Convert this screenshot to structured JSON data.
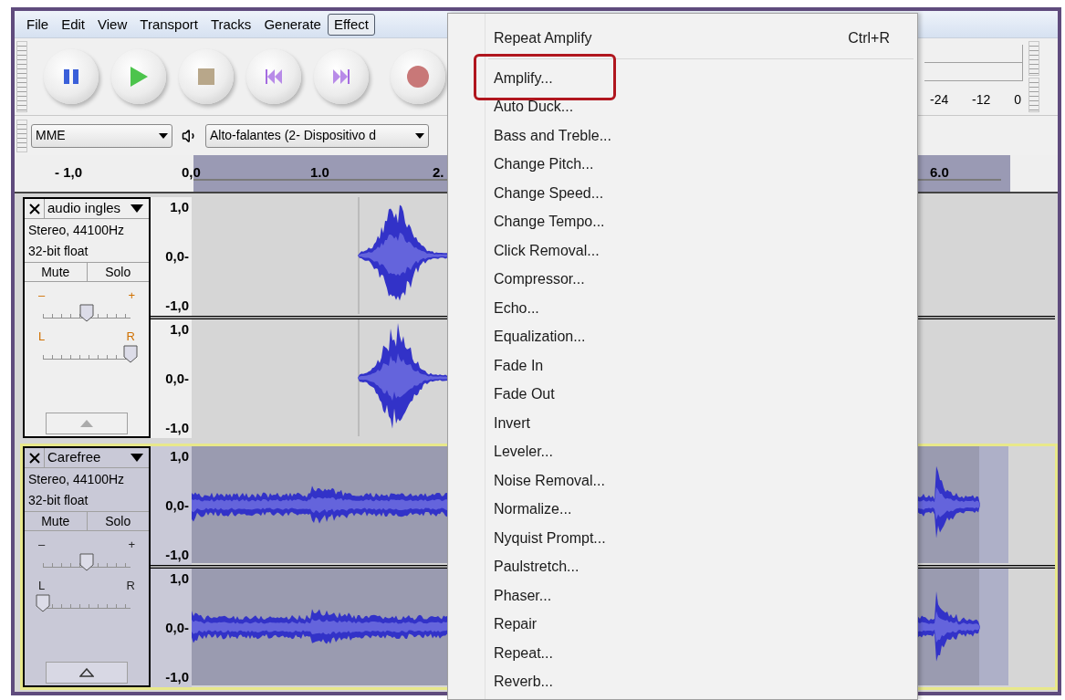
{
  "menubar": [
    {
      "label": "File",
      "selected": false
    },
    {
      "label": "Edit",
      "selected": false
    },
    {
      "label": "View",
      "selected": false
    },
    {
      "label": "Transport",
      "selected": false
    },
    {
      "label": "Tracks",
      "selected": false
    },
    {
      "label": "Generate",
      "selected": false
    },
    {
      "label": "Effect",
      "selected": true
    }
  ],
  "transport_buttons": [
    {
      "kind": "pause"
    },
    {
      "kind": "play"
    },
    {
      "kind": "stop"
    },
    {
      "kind": "skip-start"
    },
    {
      "kind": "skip-end"
    },
    {
      "kind": "record"
    }
  ],
  "meter": {
    "labels": [
      "-24",
      "-12",
      "0"
    ]
  },
  "device_toolbar": {
    "host": "MME",
    "output_device": "Alto-falantes (2- Dispositivo d"
  },
  "ruler": {
    "labels": [
      "- 1,0",
      "0,0",
      "1.0",
      "2.",
      "6.0"
    ]
  },
  "tracks": [
    {
      "name": "audio ingles",
      "info": [
        "Stereo, 44100Hz",
        "32-bit float"
      ],
      "mute": "Mute",
      "solo": "Solo",
      "selected": false,
      "gain": {
        "min_label": "–",
        "max_label": "+",
        "level": 0.5
      },
      "pan": {
        "min_label": "L",
        "max_label": "R",
        "level": 1
      },
      "channels": [
        {
          "scale": [
            "1,0",
            "0,0-",
            "-1,0"
          ]
        },
        {
          "scale": [
            "1,0",
            "0,0-",
            "-1,0"
          ]
        }
      ]
    },
    {
      "name": "Carefree",
      "info": [
        "Stereo, 44100Hz",
        "32-bit float"
      ],
      "mute": "Mute",
      "solo": "Solo",
      "selected": true,
      "gain": {
        "min_label": "–",
        "max_label": "+",
        "level": 0.5
      },
      "pan": {
        "min_label": "L",
        "max_label": "R",
        "level": 0
      },
      "channels": [
        {
          "scale": [
            "1,0",
            "0,0-",
            "-1,0"
          ]
        },
        {
          "scale": [
            "1,0",
            "0,0-",
            "-1,0"
          ]
        }
      ]
    }
  ],
  "effect_menu": {
    "recent": {
      "label": "Repeat Amplify",
      "shortcut": "Ctrl+R"
    },
    "items": [
      {
        "label": "Amplify...",
        "highlighted": true
      },
      {
        "label": "Auto Duck...",
        "highlighted": false
      },
      {
        "label": "Bass and Treble...",
        "highlighted": false
      },
      {
        "label": "Change Pitch...",
        "highlighted": false
      },
      {
        "label": "Change Speed...",
        "highlighted": false
      },
      {
        "label": "Change Tempo...",
        "highlighted": false
      },
      {
        "label": "Click Removal...",
        "highlighted": false
      },
      {
        "label": "Compressor...",
        "highlighted": false
      },
      {
        "label": "Echo...",
        "highlighted": false
      },
      {
        "label": "Equalization...",
        "highlighted": false
      },
      {
        "label": "Fade In",
        "highlighted": false
      },
      {
        "label": "Fade Out",
        "highlighted": false
      },
      {
        "label": "Invert",
        "highlighted": false
      },
      {
        "label": "Leveler...",
        "highlighted": false
      },
      {
        "label": "Noise Removal...",
        "highlighted": false
      },
      {
        "label": "Normalize...",
        "highlighted": false
      },
      {
        "label": "Nyquist Prompt...",
        "highlighted": false
      },
      {
        "label": "Paulstretch...",
        "highlighted": false
      },
      {
        "label": "Phaser...",
        "highlighted": false
      },
      {
        "label": "Repair",
        "highlighted": false
      },
      {
        "label": "Repeat...",
        "highlighted": false
      },
      {
        "label": "Reverb...",
        "highlighted": false
      }
    ]
  }
}
